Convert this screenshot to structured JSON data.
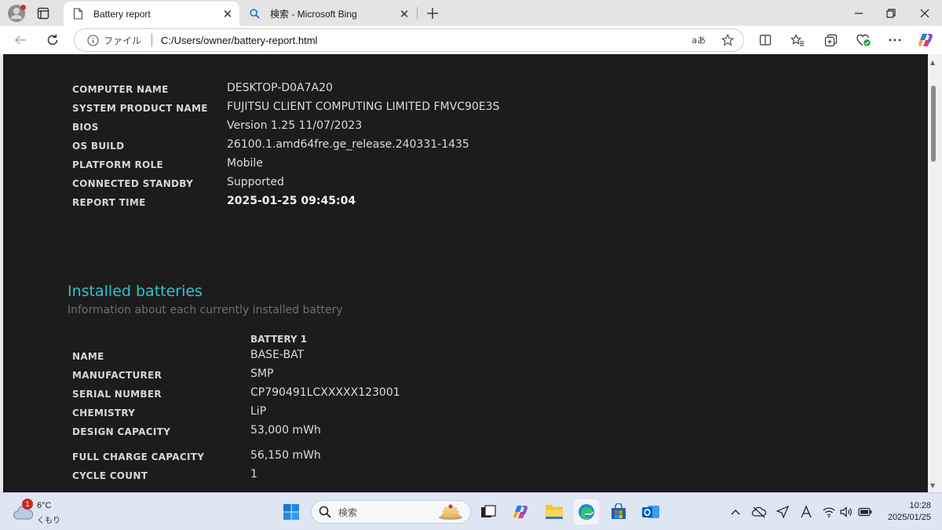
{
  "browser": {
    "tabs": [
      {
        "title": "Battery report",
        "active": true
      },
      {
        "title": "検索 - Microsoft Bing",
        "active": false
      }
    ],
    "address": {
      "security_label": "ファイル",
      "url": "C:/Users/owner/battery-report.html"
    },
    "read_aloud_label": "aあ"
  },
  "system_info": [
    {
      "key": "COMPUTER NAME",
      "value": "DESKTOP-D0A7A20"
    },
    {
      "key": "SYSTEM PRODUCT NAME",
      "value": "FUJITSU CLIENT COMPUTING LIMITED FMVC90E3S"
    },
    {
      "key": "BIOS",
      "value": "Version 1.25 11/07/2023"
    },
    {
      "key": "OS BUILD",
      "value": "26100.1.amd64fre.ge_release.240331-1435"
    },
    {
      "key": "PLATFORM ROLE",
      "value": "Mobile"
    },
    {
      "key": "CONNECTED STANDBY",
      "value": "Supported"
    },
    {
      "key": "REPORT TIME",
      "value": "2025-01-25  09:45:04"
    }
  ],
  "installed_batteries": {
    "title": "Installed batteries",
    "subtitle": "Information about each currently installed battery",
    "column_header": "BATTERY 1",
    "rows": [
      {
        "key": "NAME",
        "value": "BASE-BAT"
      },
      {
        "key": "MANUFACTURER",
        "value": "SMP"
      },
      {
        "key": "SERIAL NUMBER",
        "value": "CP790491LCXXXXX123001"
      },
      {
        "key": "CHEMISTRY",
        "value": "LiP"
      },
      {
        "key": "DESIGN CAPACITY",
        "value": "53,000 mWh"
      },
      {
        "key": "FULL CHARGE CAPACITY",
        "value": "56,150 mWh"
      },
      {
        "key": "CYCLE COUNT",
        "value": "1"
      }
    ]
  },
  "taskbar": {
    "weather": {
      "temp": "6°C",
      "condition": "くもり",
      "badge": "1"
    },
    "search_label": "検索",
    "clock": {
      "time": "10:28",
      "date": "2025/01/25"
    }
  }
}
